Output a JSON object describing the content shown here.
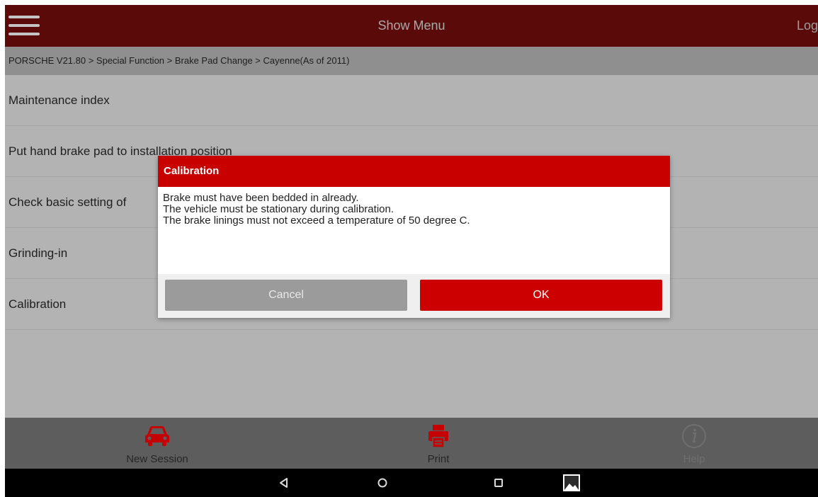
{
  "header": {
    "title": "Show Menu",
    "login": "Login"
  },
  "breadcrumb": "PORSCHE V21.80 > Special Function > Brake Pad Change > Cayenne(As of 2011)",
  "list": {
    "items": [
      "Maintenance index",
      "Put hand brake pad to installation position",
      "Check basic setting of",
      "Grinding-in",
      "Calibration"
    ]
  },
  "dialog": {
    "title": "Calibration",
    "lines": [
      "Brake must have been bedded in already.",
      "The vehicle must be stationary during calibration.",
      "The brake linings must not exceed a temperature of 50 degree C."
    ],
    "cancel": "Cancel",
    "ok": "OK"
  },
  "toolbar": {
    "new_session": "New Session",
    "print": "Print",
    "help": "Help"
  },
  "icons": {
    "menu": "hamburger-icon",
    "new_session": "car-icon",
    "print": "printer-icon",
    "help": "info-icon",
    "back": "back-triangle-icon",
    "home": "home-circle-icon",
    "recents": "recents-square-icon",
    "screenshot": "gallery-icon"
  },
  "colors": {
    "accent": "#c90000",
    "header_bg": "#5b0a0a",
    "toolbar_icon": "#c40000"
  }
}
